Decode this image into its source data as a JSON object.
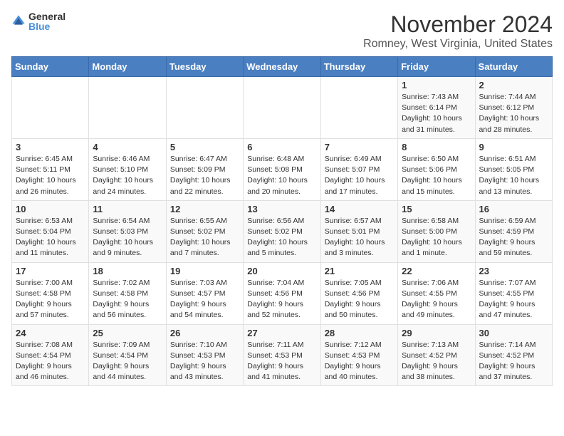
{
  "logo": {
    "general": "General",
    "blue": "Blue"
  },
  "title": "November 2024",
  "location": "Romney, West Virginia, United States",
  "weekdays": [
    "Sunday",
    "Monday",
    "Tuesday",
    "Wednesday",
    "Thursday",
    "Friday",
    "Saturday"
  ],
  "weeks": [
    [
      {
        "day": "",
        "info": ""
      },
      {
        "day": "",
        "info": ""
      },
      {
        "day": "",
        "info": ""
      },
      {
        "day": "",
        "info": ""
      },
      {
        "day": "",
        "info": ""
      },
      {
        "day": "1",
        "info": "Sunrise: 7:43 AM\nSunset: 6:14 PM\nDaylight: 10 hours\nand 31 minutes."
      },
      {
        "day": "2",
        "info": "Sunrise: 7:44 AM\nSunset: 6:12 PM\nDaylight: 10 hours\nand 28 minutes."
      }
    ],
    [
      {
        "day": "3",
        "info": "Sunrise: 6:45 AM\nSunset: 5:11 PM\nDaylight: 10 hours\nand 26 minutes."
      },
      {
        "day": "4",
        "info": "Sunrise: 6:46 AM\nSunset: 5:10 PM\nDaylight: 10 hours\nand 24 minutes."
      },
      {
        "day": "5",
        "info": "Sunrise: 6:47 AM\nSunset: 5:09 PM\nDaylight: 10 hours\nand 22 minutes."
      },
      {
        "day": "6",
        "info": "Sunrise: 6:48 AM\nSunset: 5:08 PM\nDaylight: 10 hours\nand 20 minutes."
      },
      {
        "day": "7",
        "info": "Sunrise: 6:49 AM\nSunset: 5:07 PM\nDaylight: 10 hours\nand 17 minutes."
      },
      {
        "day": "8",
        "info": "Sunrise: 6:50 AM\nSunset: 5:06 PM\nDaylight: 10 hours\nand 15 minutes."
      },
      {
        "day": "9",
        "info": "Sunrise: 6:51 AM\nSunset: 5:05 PM\nDaylight: 10 hours\nand 13 minutes."
      }
    ],
    [
      {
        "day": "10",
        "info": "Sunrise: 6:53 AM\nSunset: 5:04 PM\nDaylight: 10 hours\nand 11 minutes."
      },
      {
        "day": "11",
        "info": "Sunrise: 6:54 AM\nSunset: 5:03 PM\nDaylight: 10 hours\nand 9 minutes."
      },
      {
        "day": "12",
        "info": "Sunrise: 6:55 AM\nSunset: 5:02 PM\nDaylight: 10 hours\nand 7 minutes."
      },
      {
        "day": "13",
        "info": "Sunrise: 6:56 AM\nSunset: 5:02 PM\nDaylight: 10 hours\nand 5 minutes."
      },
      {
        "day": "14",
        "info": "Sunrise: 6:57 AM\nSunset: 5:01 PM\nDaylight: 10 hours\nand 3 minutes."
      },
      {
        "day": "15",
        "info": "Sunrise: 6:58 AM\nSunset: 5:00 PM\nDaylight: 10 hours\nand 1 minute."
      },
      {
        "day": "16",
        "info": "Sunrise: 6:59 AM\nSunset: 4:59 PM\nDaylight: 9 hours\nand 59 minutes."
      }
    ],
    [
      {
        "day": "17",
        "info": "Sunrise: 7:00 AM\nSunset: 4:58 PM\nDaylight: 9 hours\nand 57 minutes."
      },
      {
        "day": "18",
        "info": "Sunrise: 7:02 AM\nSunset: 4:58 PM\nDaylight: 9 hours\nand 56 minutes."
      },
      {
        "day": "19",
        "info": "Sunrise: 7:03 AM\nSunset: 4:57 PM\nDaylight: 9 hours\nand 54 minutes."
      },
      {
        "day": "20",
        "info": "Sunrise: 7:04 AM\nSunset: 4:56 PM\nDaylight: 9 hours\nand 52 minutes."
      },
      {
        "day": "21",
        "info": "Sunrise: 7:05 AM\nSunset: 4:56 PM\nDaylight: 9 hours\nand 50 minutes."
      },
      {
        "day": "22",
        "info": "Sunrise: 7:06 AM\nSunset: 4:55 PM\nDaylight: 9 hours\nand 49 minutes."
      },
      {
        "day": "23",
        "info": "Sunrise: 7:07 AM\nSunset: 4:55 PM\nDaylight: 9 hours\nand 47 minutes."
      }
    ],
    [
      {
        "day": "24",
        "info": "Sunrise: 7:08 AM\nSunset: 4:54 PM\nDaylight: 9 hours\nand 46 minutes."
      },
      {
        "day": "25",
        "info": "Sunrise: 7:09 AM\nSunset: 4:54 PM\nDaylight: 9 hours\nand 44 minutes."
      },
      {
        "day": "26",
        "info": "Sunrise: 7:10 AM\nSunset: 4:53 PM\nDaylight: 9 hours\nand 43 minutes."
      },
      {
        "day": "27",
        "info": "Sunrise: 7:11 AM\nSunset: 4:53 PM\nDaylight: 9 hours\nand 41 minutes."
      },
      {
        "day": "28",
        "info": "Sunrise: 7:12 AM\nSunset: 4:53 PM\nDaylight: 9 hours\nand 40 minutes."
      },
      {
        "day": "29",
        "info": "Sunrise: 7:13 AM\nSunset: 4:52 PM\nDaylight: 9 hours\nand 38 minutes."
      },
      {
        "day": "30",
        "info": "Sunrise: 7:14 AM\nSunset: 4:52 PM\nDaylight: 9 hours\nand 37 minutes."
      }
    ]
  ]
}
